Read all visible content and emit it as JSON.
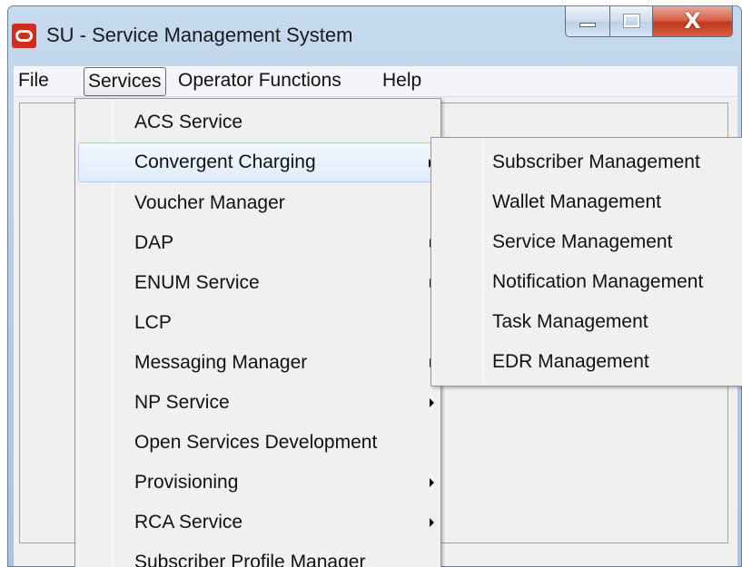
{
  "window": {
    "title": "SU - Service Management System",
    "controls": {
      "minimize": "minimize",
      "maximize": "maximize",
      "close": "X"
    }
  },
  "menubar": {
    "items": [
      "File",
      "Services",
      "Operator Functions",
      "Help"
    ],
    "active": "Services"
  },
  "services_menu": {
    "items": [
      {
        "label": "ACS Service",
        "submenu": false
      },
      {
        "label": "Convergent Charging",
        "submenu": true,
        "highlighted": true
      },
      {
        "label": "Voucher Manager",
        "submenu": false
      },
      {
        "label": "DAP",
        "submenu": true
      },
      {
        "label": "ENUM Service",
        "submenu": true
      },
      {
        "label": "LCP",
        "submenu": false
      },
      {
        "label": "Messaging Manager",
        "submenu": true
      },
      {
        "label": "NP Service",
        "submenu": true
      },
      {
        "label": "Open Services Development",
        "submenu": false
      },
      {
        "label": "Provisioning",
        "submenu": true
      },
      {
        "label": "RCA Service",
        "submenu": true
      },
      {
        "label": "Subscriber Profile Manager",
        "submenu": false
      }
    ]
  },
  "convergent_charging_submenu": {
    "items": [
      "Subscriber Management",
      "Wallet Management",
      "Service Management",
      "Notification Management",
      "Task Management",
      "EDR Management"
    ]
  },
  "colors": {
    "title_gradient": "#b9cfe6",
    "highlight_border": "#aeccf2",
    "close_button": "#c2381c",
    "app_icon": "#d32b1e"
  }
}
